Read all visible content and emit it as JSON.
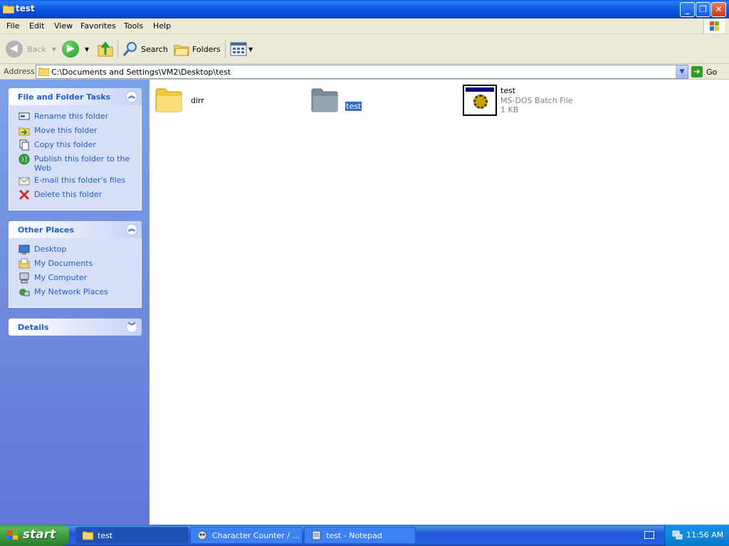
{
  "window": {
    "title": "test",
    "minimize_icon": "minimize-icon",
    "maximize_icon": "restore-icon",
    "close_icon": "close-icon"
  },
  "menu": [
    "File",
    "Edit",
    "View",
    "Favorites",
    "Tools",
    "Help"
  ],
  "toolbar": {
    "back": "Back",
    "search": "Search",
    "folders": "Folders"
  },
  "address": {
    "label": "Address",
    "value": "C:\\Documents and Settings\\VM2\\Desktop\\test",
    "go": "Go"
  },
  "file_tasks": {
    "title": "File and Folder Tasks",
    "items": [
      "Rename this folder",
      "Move this folder",
      "Copy this folder",
      "Publish this folder to the Web",
      "E-mail this folder's files",
      "Delete this folder"
    ]
  },
  "other_places": {
    "title": "Other Places",
    "items": [
      "Desktop",
      "My Documents",
      "My Computer",
      "My Network Places"
    ]
  },
  "details": {
    "title": "Details"
  },
  "files": [
    {
      "name": "dirr",
      "type": "folder"
    },
    {
      "name": "test",
      "type": "folder",
      "selected": true
    },
    {
      "name": "test",
      "type": "batch",
      "desc": "MS-DOS Batch File",
      "size": "1 KB"
    }
  ],
  "taskbar": {
    "start": "start",
    "tasks": [
      "test",
      "Character Counter / ...",
      "test - Notepad"
    ],
    "clock": "11:56 AM"
  },
  "colors": {
    "titlebar": "#0a5ce3",
    "panel_link": "#215dc6",
    "selection": "#316ac5",
    "taskbar": "#2157d7",
    "start_green": "#3a963a"
  }
}
